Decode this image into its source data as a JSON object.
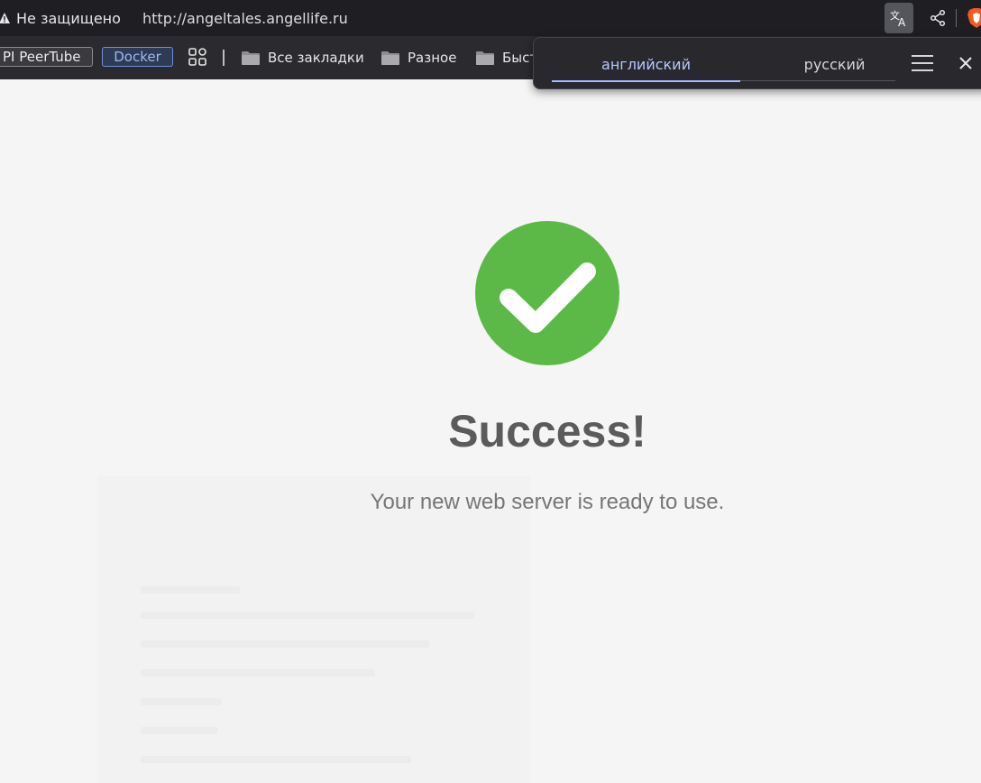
{
  "browser": {
    "security_label": "Не защищено",
    "url": "http://angeltales.angellife.ru",
    "icons": {
      "warning": "warning-icon",
      "translate": "translate-icon",
      "share": "share-icon",
      "brave": "brave-lion-icon"
    }
  },
  "bookmarks": {
    "items": [
      {
        "label": "PI PeerTube",
        "type": "chip"
      },
      {
        "label": "Docker",
        "type": "chip"
      },
      {
        "label": "Все закладки",
        "type": "folder"
      },
      {
        "label": "Разное",
        "type": "folder"
      },
      {
        "label": "Быст",
        "type": "folder"
      }
    ],
    "apps_icon": "apps-grid-icon"
  },
  "translate_popup": {
    "source_language": "английский",
    "target_language": "русский",
    "active_tab": "английский",
    "icons": {
      "menu": "hamburger-menu-icon",
      "close": "close-icon"
    }
  },
  "page": {
    "title": "Success!",
    "subtitle": "Your new web server is ready to use.",
    "icon": "check-circle-icon",
    "colors": {
      "success_green": "#5cb947",
      "text_dark": "#5b5b5b",
      "text_muted": "#767676",
      "background": "#f5f5f5"
    }
  }
}
